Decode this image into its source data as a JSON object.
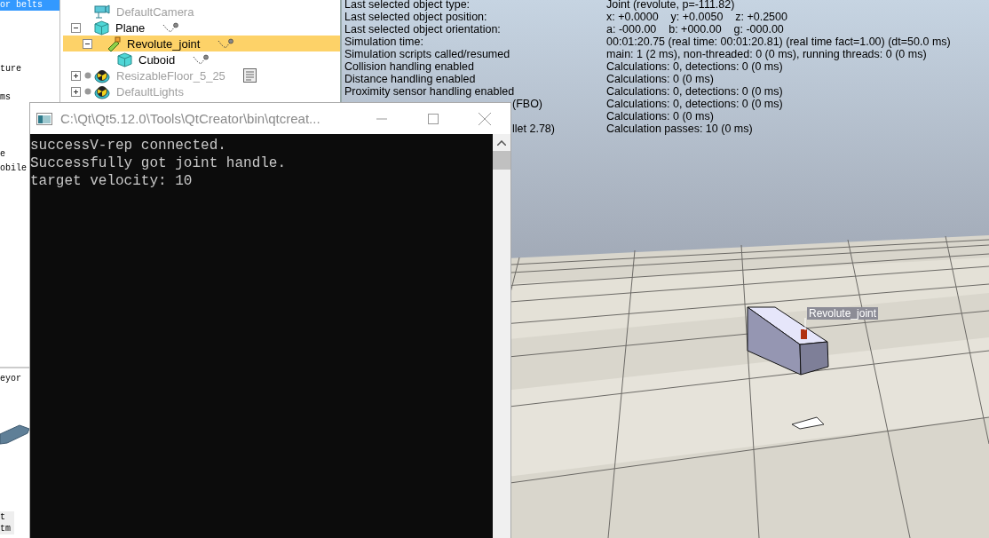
{
  "model_browser": {
    "items": [
      {
        "label": "or belts",
        "selected": true
      },
      {
        "label": "ture",
        "selected": false
      },
      {
        "label": "ms",
        "selected": false
      },
      {
        "label": "e",
        "selected": false
      },
      {
        "label": "obile",
        "selected": false
      }
    ],
    "preview_label": "eyor",
    "bottom_items": [
      "t",
      "tm"
    ]
  },
  "scene_hierarchy": [
    {
      "label": "DefaultCamera",
      "kind": "camera",
      "dimmed": true,
      "selected": false
    },
    {
      "label": "Plane",
      "kind": "shape",
      "dimmed": false,
      "selected": false,
      "expanded": true,
      "has_dynamics": true,
      "children": [
        {
          "label": "Revolute_joint",
          "kind": "joint",
          "dimmed": false,
          "selected": true,
          "expanded": true,
          "has_dynamics": true,
          "children": [
            {
              "label": "Cuboid",
              "kind": "shape",
              "dimmed": false,
              "selected": false,
              "has_dynamics": true
            }
          ]
        }
      ]
    },
    {
      "label": "ResizableFloor_5_25",
      "kind": "floor",
      "dimmed": true,
      "selected": false,
      "expanded": false,
      "has_script": true
    },
    {
      "label": "DefaultLights",
      "kind": "floor",
      "dimmed": true,
      "selected": false,
      "expanded": false
    }
  ],
  "info": [
    {
      "label": "Last selected object type:",
      "value": "Joint (revolute, p=-111.82)"
    },
    {
      "label": "Last selected object position:",
      "value": "x: +0.0000    y: +0.0050    z: +0.2500"
    },
    {
      "label": "Last selected object orientation:",
      "value": "a: -000.00    b: +000.00    g: -000.00"
    },
    {
      "label": "Simulation time:",
      "value": "00:01:20.75 (real time: 00:01:20.81) (real time fact=1.00) (dt=50.0 ms)"
    },
    {
      "label": "Simulation scripts called/resumed",
      "value": "main: 1 (2 ms), non-threaded: 0 (0 ms), running threads: 0 (0 ms)"
    },
    {
      "label": "Collision handling enabled",
      "value": "Calculations: 0, detections: 0 (0 ms)"
    },
    {
      "label": "Distance handling enabled",
      "value": "Calculations: 0 (0 ms)"
    },
    {
      "label": "Proximity sensor handling enabled",
      "value": "Calculations: 0, detections: 0 (0 ms)"
    },
    {
      "label": "(FBO)",
      "label_cut": true,
      "value": "Calculations: 0, detections: 0 (0 ms)"
    },
    {
      "value": "Calculations: 0 (0 ms)"
    },
    {
      "label": "llet 2.78)",
      "label_cut": true,
      "value": "Calculation passes: 10 (0 ms)"
    }
  ],
  "scene_label": "Revolute_joint",
  "console": {
    "title": "C:\\Qt\\Qt5.12.0\\Tools\\QtCreator\\bin\\qtcreat...",
    "lines": [
      "successV-rep connected.",
      "Successfully got joint handle.",
      "target velocity: 10"
    ]
  }
}
